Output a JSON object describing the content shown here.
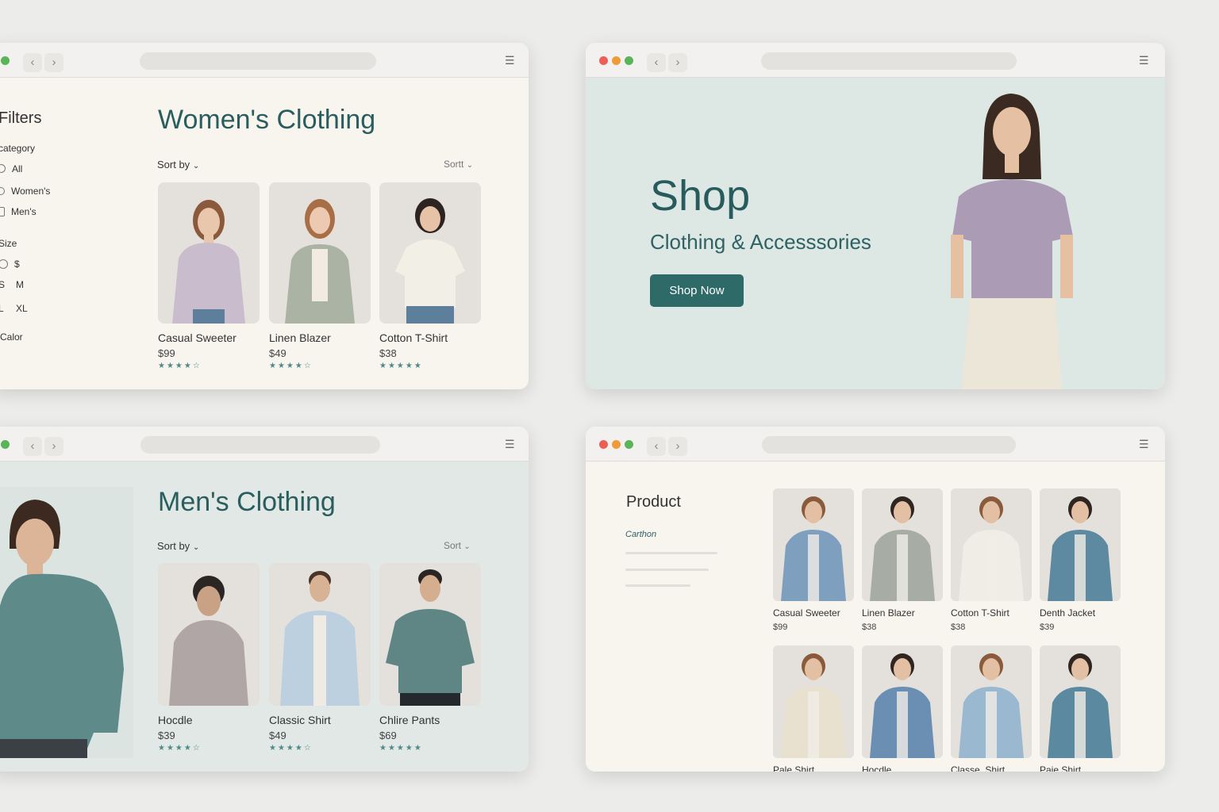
{
  "windows": {
    "women": {
      "title": "Women's Clothing",
      "sort_label": "Sort by",
      "sort_right": "Sortt",
      "filters": {
        "heading": "Filters",
        "category_label": "category",
        "categories": [
          "All",
          "Women's",
          "Men's"
        ],
        "size_label": "Size",
        "sizes": [
          "$",
          "S",
          "M",
          "L",
          "XL"
        ],
        "color_label": "Calor",
        "colors": [
          "#7aa587",
          "#e7d4bb",
          "#55585e",
          "#63666e"
        ]
      },
      "products": [
        {
          "name": "Casual Sweeter",
          "price": "$99",
          "rating": 4,
          "garment": "#c9bdcd"
        },
        {
          "name": "Linen Blazer",
          "price": "$49",
          "rating": 4,
          "garment": "#aab3a4"
        },
        {
          "name": "Cotton T-Shirt",
          "price": "$38",
          "rating": 5,
          "garment": "#f2efe7"
        }
      ]
    },
    "hero": {
      "title": "Shop",
      "subtitle": "Clothing & Accesssories",
      "button_label": "Shop Now",
      "model_shirt": "#ab9bb5"
    },
    "men": {
      "title": "Men's Clothing",
      "sort_label": "Sort by",
      "sort_right": "Sort",
      "products": [
        {
          "name": "Hocdle",
          "price": "$39",
          "rating": 4,
          "garment": "#b1a6a6"
        },
        {
          "name": "Classic Shirt",
          "price": "$49",
          "rating": 4,
          "garment": "#bdd0df"
        },
        {
          "name": "Chlire Pants",
          "price": "$69",
          "rating": 5,
          "garment": "#5f8585"
        }
      ]
    },
    "product": {
      "title": "Product",
      "subtitle": "Carthon",
      "grid": [
        {
          "name": "Casual Sweeter",
          "price": "$99",
          "garment": "#7f9fbf"
        },
        {
          "name": "Linen Blazer",
          "price": "$38",
          "garment": "#a7ada4"
        },
        {
          "name": "Cotton T-Shirt",
          "price": "$38",
          "garment": "#f0ede6"
        },
        {
          "name": "Denth Jacket",
          "price": "$39",
          "garment": "#5d8aa0"
        },
        {
          "name": "Pale Shirt",
          "price": "",
          "garment": "#e9e1cf"
        },
        {
          "name": "Hocdle",
          "price": "",
          "garment": "#6b8eb3"
        },
        {
          "name": "Classe, Shirt",
          "price": "",
          "garment": "#9ab8cf"
        },
        {
          "name": "Paie Shirt",
          "price": "",
          "garment": "#5b8aa0"
        }
      ]
    }
  }
}
